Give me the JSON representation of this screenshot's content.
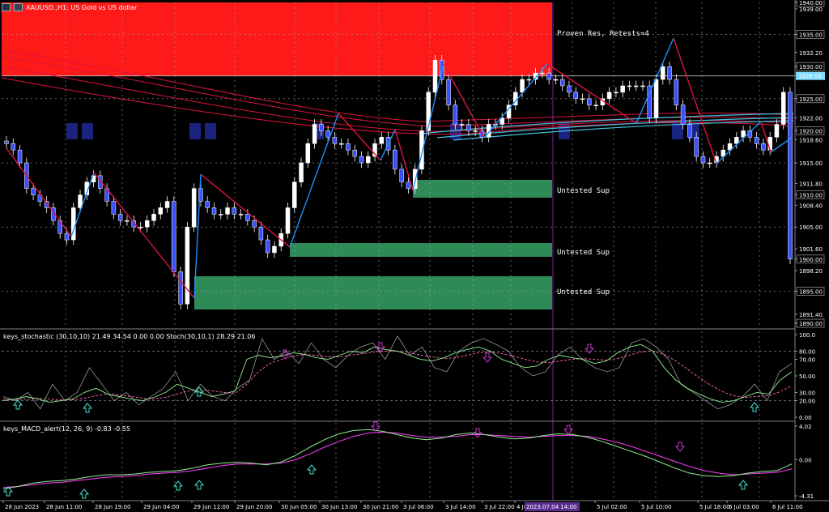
{
  "window": {
    "title": "XAUUSD.,H1: US Gold vs US dollar"
  },
  "colors": {
    "background": "#000000",
    "resistance_zone": "#ff1a1a",
    "support_zone": "#2e8b57",
    "bull_candle": "#ffffff",
    "bear_candle": "#3a50ff",
    "zigzag_up": "#1e90ff",
    "zigzag_down": "#dc143c",
    "ma_red": "#dc143c",
    "ma_cyan": "#40c0e0",
    "grid": "#9aa0a6",
    "current_price_bg": "#7fdcff",
    "stoch_main": "#90ee90",
    "stoch_signal": "#ff69b4",
    "macd_main": "#90ee90",
    "macd_signal": "#ff40ff",
    "up_arrow": "#40e0d0",
    "down_arrow": "#cc33cc",
    "vline": "#7b1fa2"
  },
  "icons": [
    "chart-window-icon",
    "tool-icon"
  ],
  "zones": {
    "resistance_label": "Proven Res, Retests=4",
    "support_label_1": "Untested Sup",
    "support_label_2": "Untested Sup",
    "support_label_3": "Untested Sup"
  },
  "price_axis": {
    "labels": [
      "1940.00",
      "1939.00",
      "1935.00",
      "1932.20",
      "1930.00",
      "1928.55",
      "1925.00",
      "1922.00",
      "1920.00",
      "1918.60",
      "1915.00",
      "1911.80",
      "1910.00",
      "1908.40",
      "1905.00",
      "1901.60",
      "1900.00",
      "1898.20",
      "1895.00",
      "1891.40",
      "1890.00"
    ],
    "current_price": "1928.55"
  },
  "stochastic": {
    "header": "keys_stochastic (30,10,10) 21.49 34.54 0.00 0.00 Stoch(30,10,1) 28.29 21.06",
    "levels": [
      "100.0",
      "80.00",
      "70.00",
      "50.00",
      "30.00",
      "20.00",
      "0.00"
    ]
  },
  "macd": {
    "header": "keys_MACD_alert(12, 26, 9) -0.83 -0.55",
    "levels": [
      "4.02",
      "0.00",
      "-4.31"
    ]
  },
  "time_axis": {
    "labels": [
      "28 Jun 2023",
      "28 Jun 11:00",
      "28 Jun 19:00",
      "29 Jun 04:00",
      "29 Jun 12:00",
      "29 Jun 20:00",
      "30 Jun 05:00",
      "30 Jun 13:00",
      "30 Jun 21:00",
      "3 Jul 06:00",
      "3 Jul 14:00",
      "3 Jul 22:00",
      "4 Jul",
      "5 Jul 02:00",
      "5 Jul 10:00",
      "5 Jul 18:00",
      "6 Jul 03:00",
      "6 Jul 11:00"
    ],
    "cursor_time": "2023.07.04 14:00"
  },
  "chart_data": {
    "type": "candlestick",
    "symbol": "XAUUSD.",
    "timeframe": "H1",
    "ylim": [
      1889.5,
      1940.0
    ],
    "closes": [
      1918,
      1917,
      1915,
      1911,
      1910,
      1909,
      1908,
      1906,
      1904,
      1903,
      1908,
      1910,
      1912,
      1913,
      1911,
      1909,
      1907,
      1906,
      1906,
      1905,
      1905,
      1906,
      1907,
      1908,
      1909,
      1898,
      1893,
      1905,
      1911,
      1909,
      1908,
      1907,
      1907,
      1908,
      1907,
      1907,
      1906,
      1905,
      1903,
      1901,
      1902,
      1904,
      1908,
      1912,
      1915,
      1918,
      1921,
      1920,
      1919,
      1918,
      1918,
      1917,
      1916,
      1915,
      1916,
      1918,
      1919,
      1917,
      1914,
      1912,
      1911,
      1914,
      1920,
      1926,
      1931,
      1928,
      1924,
      1921,
      1921,
      1920,
      1920,
      1919,
      1921,
      1921,
      1922,
      1924,
      1926,
      1928,
      1928,
      1929,
      1929,
      1928,
      1928,
      1927,
      1926,
      1925,
      1925,
      1924,
      1924,
      1925,
      1926,
      1926,
      1927,
      1927,
      1927,
      1927,
      1922,
      1928,
      1930,
      1928,
      1924,
      1921,
      1919,
      1916,
      1915,
      1915,
      1916,
      1917,
      1918,
      1919,
      1920,
      1919,
      1918,
      1917,
      1919,
      1921,
      1926,
      1900
    ]
  }
}
